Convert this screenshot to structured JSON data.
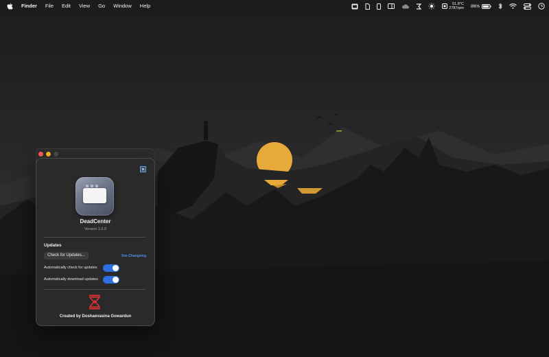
{
  "menubar": {
    "app": "Finder",
    "items": [
      "File",
      "Edit",
      "View",
      "Go",
      "Window",
      "Help"
    ],
    "stats_top": "51.8°C",
    "stats_bottom": "2787rpm",
    "battery": "86%"
  },
  "about_window": {
    "app_name": "DeadCenter",
    "version": "Version 1.0.0",
    "updates_title": "Updates",
    "check_button": "Check for Updates...",
    "changelog_link": "See Changelog",
    "auto_check_label": "Automatically check for updates",
    "auto_check_on": true,
    "auto_download_label": "Automatically download updates",
    "auto_download_on": true,
    "credit": "Created by Doshaevasina Gowardun"
  },
  "colors": {
    "accent": "#2f6fe0",
    "link": "#4e94ea",
    "sun": "#e7a93a",
    "logo": "#e03131"
  }
}
